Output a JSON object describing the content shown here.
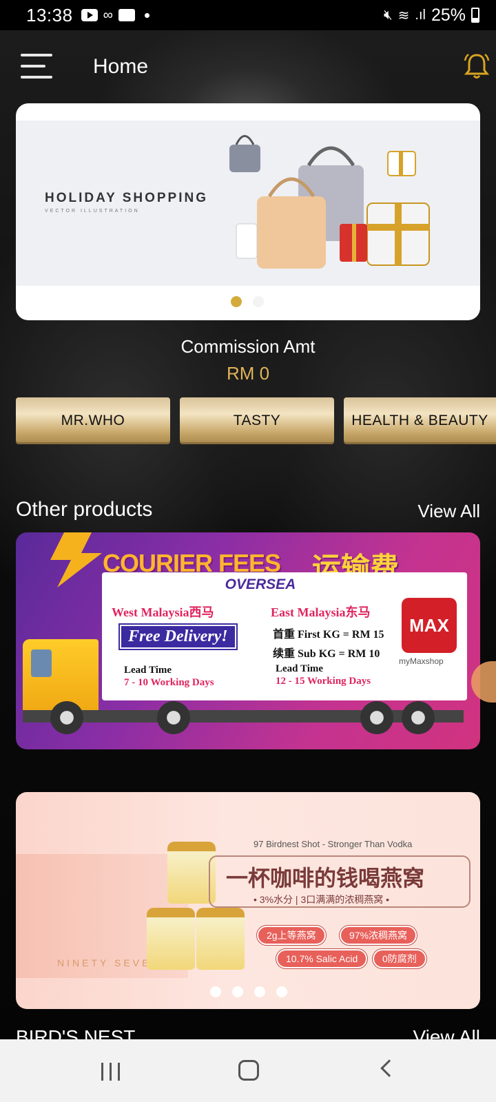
{
  "status_bar": {
    "time": "13:38",
    "battery": "25%"
  },
  "header": {
    "title": "Home"
  },
  "banner": {
    "heading": "HOLIDAY SHOPPING",
    "subheading": "VECTOR ILLUSTRATION",
    "active_slide": 1,
    "slide_count": 2
  },
  "commission": {
    "label": "Commission Amt",
    "value": "RM 0"
  },
  "categories": [
    "MR.WHO",
    "TASTY",
    "HEALTH & BEAUTY"
  ],
  "sections": {
    "other_products": {
      "title": "Other products",
      "view_all": "View All"
    },
    "birds_nest": {
      "title": "BIRD'S NEST",
      "view_all": "View All"
    }
  },
  "courier_promo": {
    "title": "COURIER FEES",
    "title_cn": "运输费",
    "oversea": "OVERSEA",
    "west": "West Malaysia西马",
    "east": "East Malaysia东马",
    "free": "Free Delivery!",
    "first_kg": "首重 First KG = RM 15",
    "sub_kg": "续重 Sub KG = RM 10",
    "lead_time_label": "Lead Time",
    "west_lead": "7 - 10 Working Days",
    "east_lead": "12 - 15 Working Days",
    "logo": "MAX",
    "logo_caption": "myMaxshop"
  },
  "birdnest_promo": {
    "small": "97 Birdnest Shot - Stronger Than Vodka",
    "headline": "一杯咖啡的钱喝燕窝",
    "sub": "• 3%水分 | 3口满满的浓稠燕窝 •",
    "pills": [
      "2g上等燕窝",
      "97%浓稠燕窝",
      "10.7% Salic Acid",
      "0防腐剂"
    ],
    "box_text": "NINETY SEVEN",
    "active_slide": 1,
    "slide_count": 4
  },
  "colors": {
    "gold": "#d4aa3a",
    "commission": "#e0b458",
    "background": "#000000"
  }
}
